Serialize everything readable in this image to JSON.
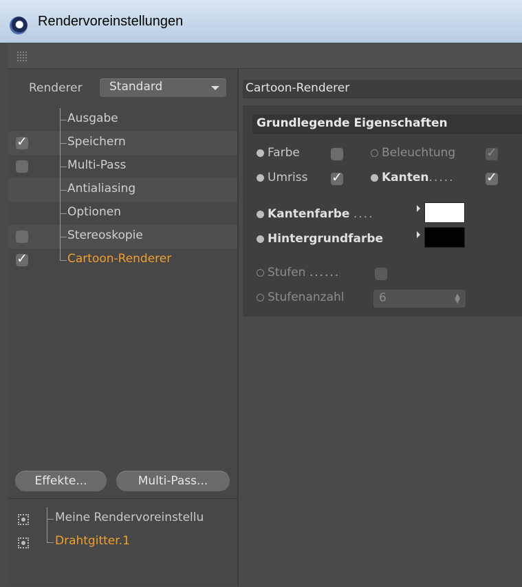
{
  "window": {
    "title": "Rendervoreinstellungen"
  },
  "left": {
    "renderer_label": "Renderer",
    "renderer_value": "Standard",
    "tree": [
      {
        "label": "Ausgabe",
        "checkbox": "none",
        "active": false
      },
      {
        "label": "Speichern",
        "checkbox": "checked",
        "active": false
      },
      {
        "label": "Multi-Pass",
        "checkbox": "unchecked",
        "active": false
      },
      {
        "label": "Antialiasing",
        "checkbox": "none",
        "active": false
      },
      {
        "label": "Optionen",
        "checkbox": "none",
        "active": false
      },
      {
        "label": "Stereoskopie",
        "checkbox": "unchecked",
        "active": false
      },
      {
        "label": "Cartoon-Renderer",
        "checkbox": "checked",
        "active": true
      }
    ],
    "effects_button": "Effekte...",
    "multipass_button": "Multi-Pass...",
    "scenes": [
      {
        "label": "Meine Rendervoreinstellu",
        "active": false
      },
      {
        "label": "Drahtgitter.1",
        "active": true
      }
    ]
  },
  "right": {
    "header": "Cartoon-Renderer",
    "group_title": "Grundlegende Eigenschaften",
    "farbe": {
      "label": "Farbe",
      "checked": false
    },
    "beleuchtung": {
      "label": "Beleuchtung",
      "checked": true,
      "enabled": false
    },
    "umriss": {
      "label": "Umriss",
      "checked": true
    },
    "kanten": {
      "label": "Kanten",
      "dots": ".....",
      "checked": true
    },
    "kantenfarbe": {
      "label": "Kantenfarbe",
      "dots": "....",
      "color": "#ffffff"
    },
    "hintergrundfarbe": {
      "label": "Hintergrundfarbe",
      "color": "#000000"
    },
    "stufen": {
      "label": "Stufen",
      "dots": "......",
      "checked": false,
      "enabled": false
    },
    "stufenanzahl": {
      "label": "Stufenanzahl",
      "value": "6",
      "enabled": false
    }
  },
  "colors": {
    "accent": "#f0a030",
    "panel": "#4a4a4a",
    "title_bar": "#c5d6ea"
  }
}
